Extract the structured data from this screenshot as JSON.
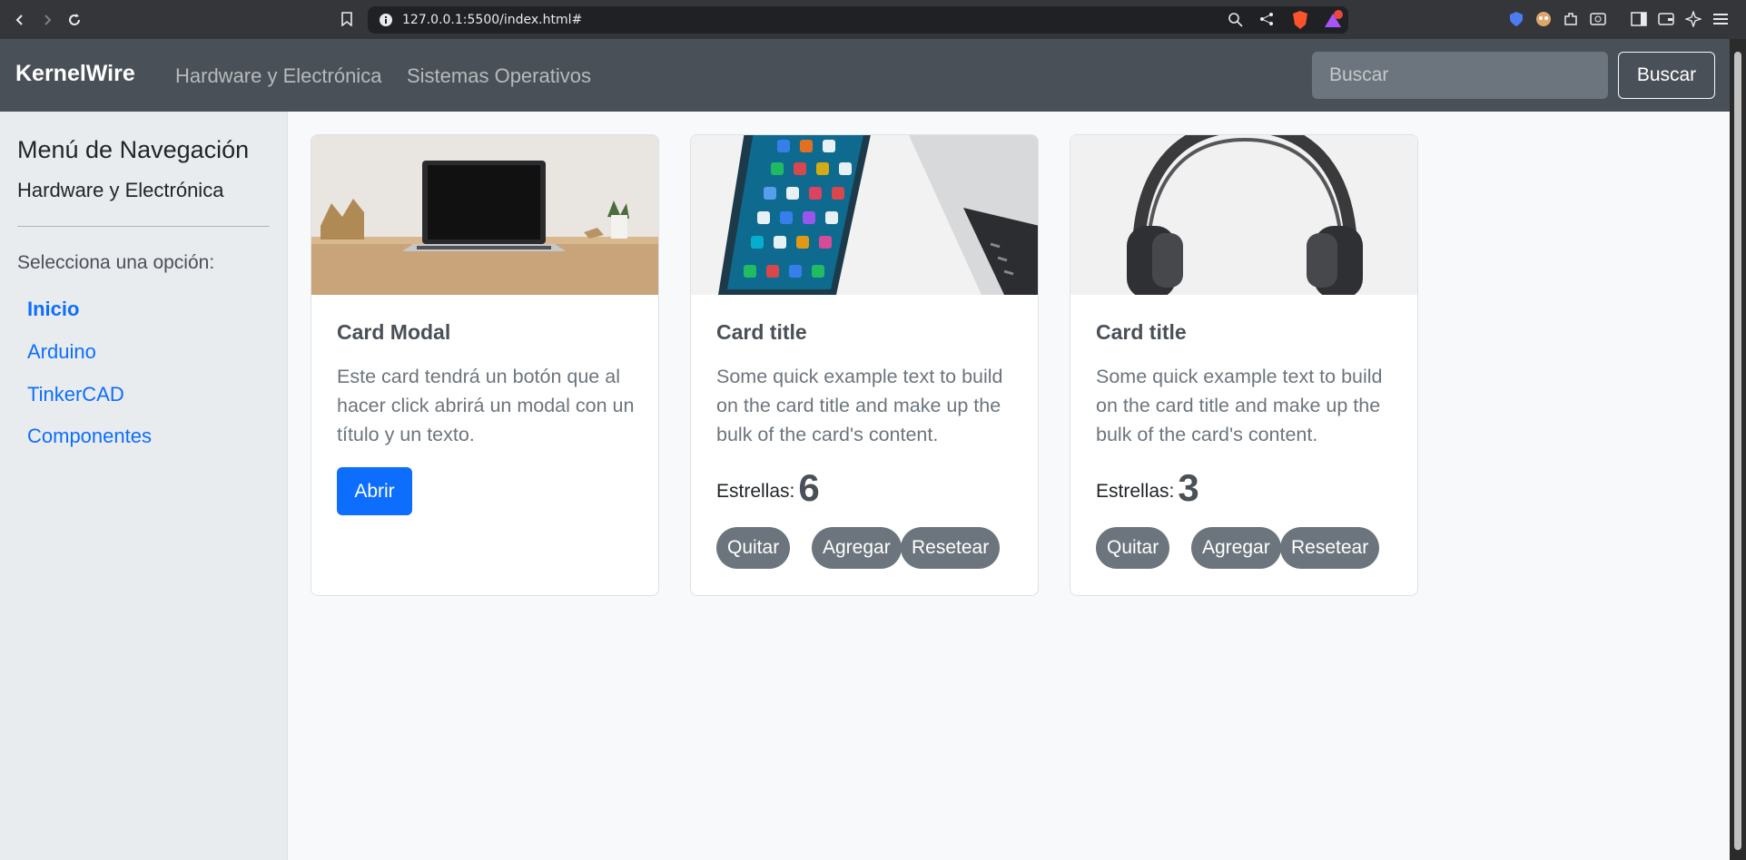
{
  "browser": {
    "url": "127.0.0.1:5500/index.html#",
    "notification_count": "1"
  },
  "navbar": {
    "brand": "KernelWire",
    "links": [
      "Hardware y Electrónica",
      "Sistemas Operativos"
    ],
    "search_placeholder": "Buscar",
    "search_button": "Buscar"
  },
  "sidebar": {
    "title": "Menú de Navegación",
    "subtitle": "Hardware y Electrónica",
    "prompt": "Selecciona una opción:",
    "items": [
      "Inicio",
      "Arduino",
      "TinkerCAD",
      "Componentes"
    ]
  },
  "cards": [
    {
      "title": "Card Modal",
      "text": "Este card tendrá un botón que al hacer click abrirá un modal con un título y un texto.",
      "button": "Abrir"
    },
    {
      "title": "Card title",
      "text": "Some quick example text to build on the card title and make up the bulk of the card's content.",
      "stars_label": "Estrellas:",
      "stars_value": "6",
      "buttons": [
        "Quitar",
        "Agregar",
        "Resetear"
      ]
    },
    {
      "title": "Card title",
      "text": "Some quick example text to build on the card title and make up the bulk of the card's content.",
      "stars_label": "Estrellas:",
      "stars_value": "3",
      "buttons": [
        "Quitar",
        "Agregar",
        "Resetear"
      ]
    }
  ]
}
